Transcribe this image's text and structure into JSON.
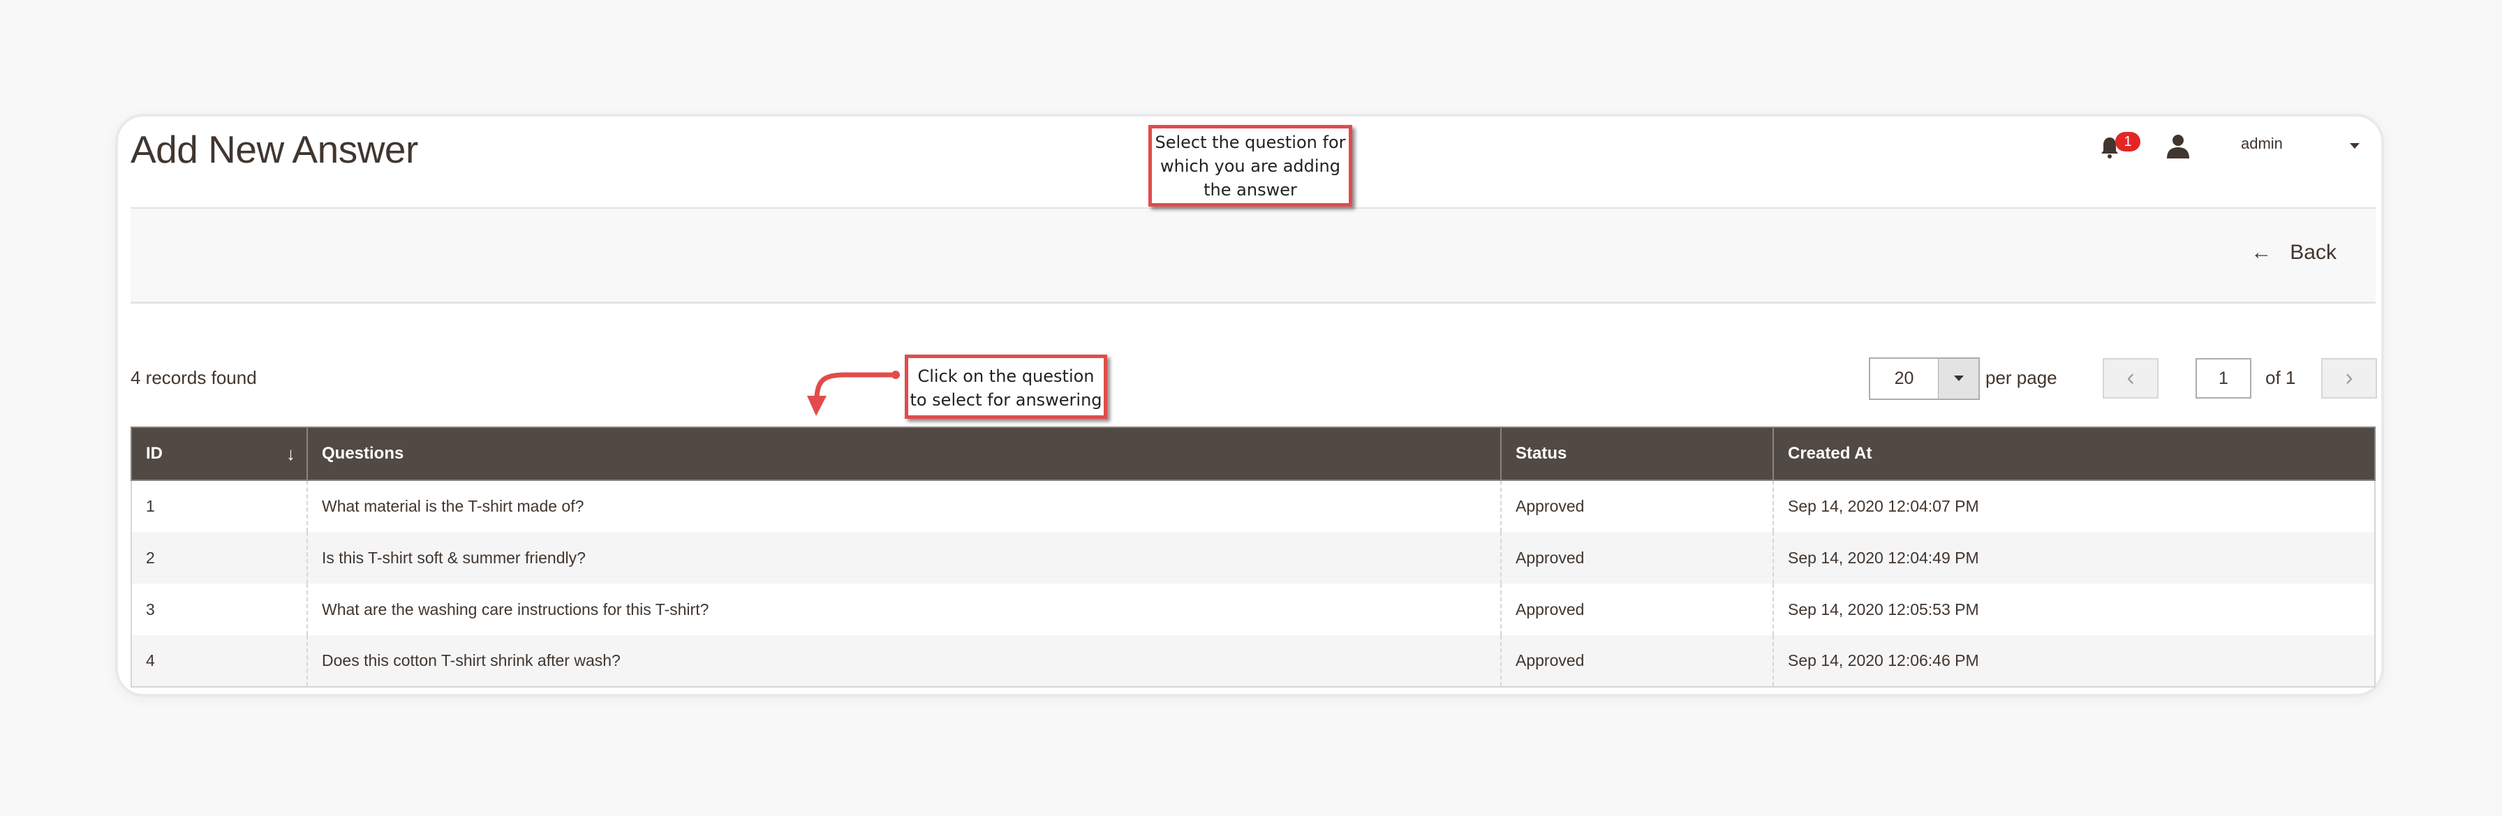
{
  "header": {
    "title": "Add New Answer",
    "notifications_count": "1",
    "username": "admin",
    "icons": {
      "notifications": "bell-icon",
      "user": "user-icon",
      "menu": "caret-down-icon"
    }
  },
  "action_bar": {
    "back_label": "Back",
    "back_icon": "←"
  },
  "toolbar": {
    "records_found": "4 records found",
    "per_page_value": "20",
    "per_page_label": "per page",
    "prev_label": "‹",
    "next_label": "›",
    "current_page": "1",
    "of_pages": "of 1"
  },
  "grid": {
    "columns": [
      {
        "label": "ID",
        "sorted": "desc",
        "sort_icon": "↓"
      },
      {
        "label": "Questions"
      },
      {
        "label": "Status"
      },
      {
        "label": "Created At"
      }
    ],
    "rows": [
      {
        "id": "1",
        "question": "What material is the T-shirt made of?",
        "status": "Approved",
        "created_at": "Sep 14, 2020 12:04:07 PM"
      },
      {
        "id": "2",
        "question": "Is this T-shirt soft & summer friendly?",
        "status": "Approved",
        "created_at": "Sep 14, 2020 12:04:49 PM"
      },
      {
        "id": "3",
        "question": "What are the washing care instructions for this T-shirt?",
        "status": "Approved",
        "created_at": "Sep 14, 2020 12:05:53 PM"
      },
      {
        "id": "4",
        "question": "Does this cotton T-shirt shrink after wash?",
        "status": "Approved",
        "created_at": "Sep 14, 2020 12:06:46 PM"
      }
    ]
  },
  "annotations": {
    "callout_top": {
      "lines": [
        "Select the question for",
        "which you are adding",
        "the answer"
      ]
    },
    "callout_table": {
      "lines": [
        "Click on the question",
        "to select for answering"
      ]
    },
    "color": "#e24b4b"
  },
  "colors": {
    "header_bg": "#514943",
    "badge": "#e22626",
    "text": "#41362f"
  }
}
